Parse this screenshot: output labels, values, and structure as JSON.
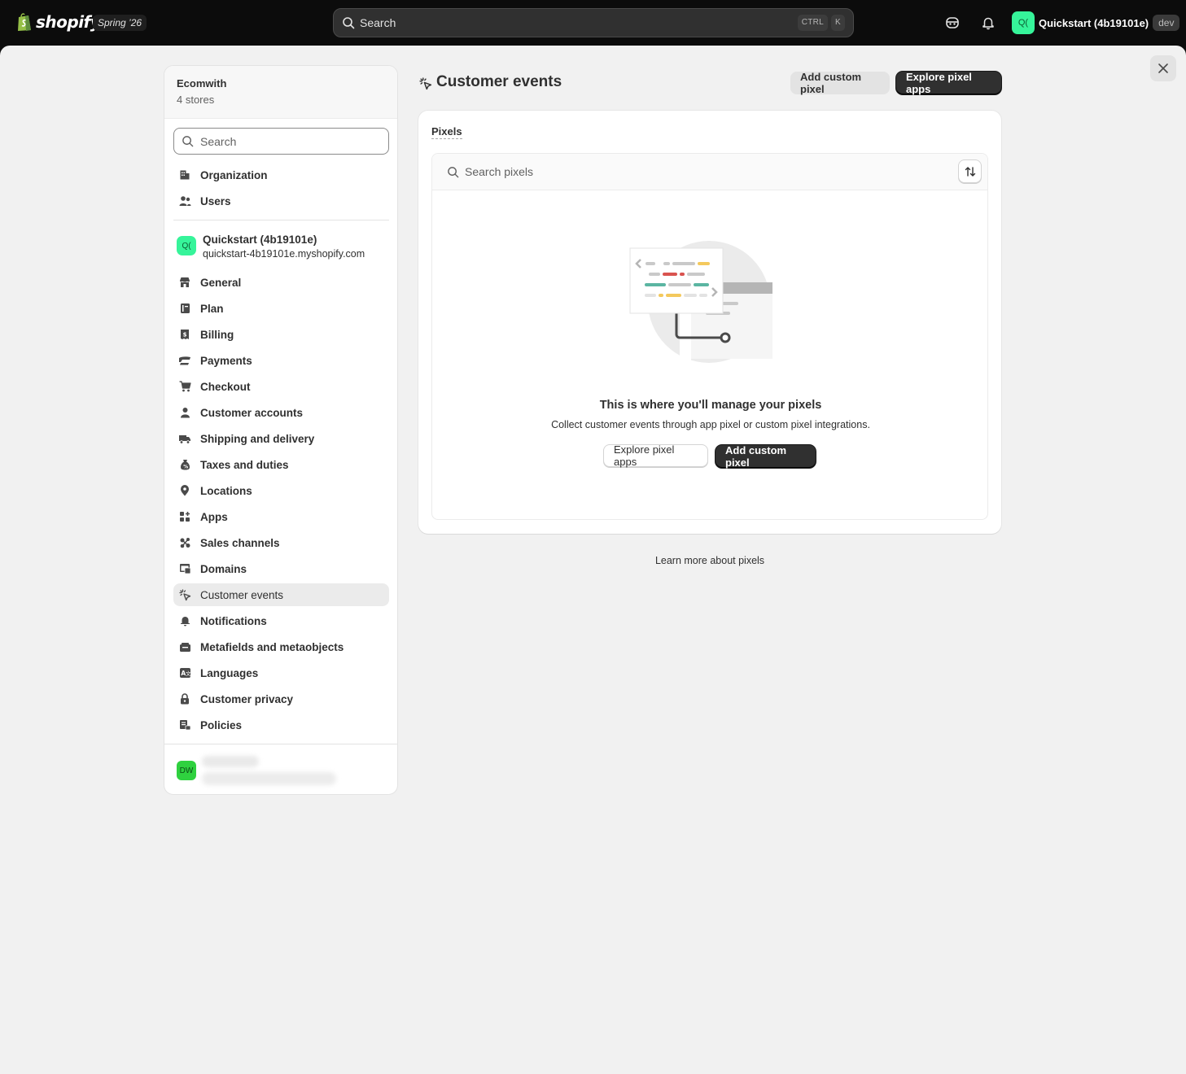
{
  "topbar": {
    "brand": "shopify",
    "release": "Spring ’26",
    "search_placeholder": "Search",
    "shortcut_ctrl": "CTRL",
    "shortcut_key": "K",
    "store_avatar": "Q(",
    "store_name": "Quickstart (4b19101e)",
    "store_tag": "dev"
  },
  "sidebar": {
    "org_name": "Ecomwith",
    "org_stores": "4 stores",
    "search_placeholder": "Search",
    "org_items": [
      {
        "label": "Organization",
        "icon": "organization-icon"
      },
      {
        "label": "Users",
        "icon": "users-icon"
      }
    ],
    "store": {
      "avatar": "Q(",
      "name": "Quickstart (4b19101e)",
      "url": "quickstart-4b19101e.myshopify.com"
    },
    "items": [
      {
        "label": "General",
        "icon": "store-icon"
      },
      {
        "label": "Plan",
        "icon": "plan-icon"
      },
      {
        "label": "Billing",
        "icon": "billing-icon"
      },
      {
        "label": "Payments",
        "icon": "payments-icon"
      },
      {
        "label": "Checkout",
        "icon": "cart-icon"
      },
      {
        "label": "Customer accounts",
        "icon": "person-icon"
      },
      {
        "label": "Shipping and delivery",
        "icon": "truck-icon"
      },
      {
        "label": "Taxes and duties",
        "icon": "tax-icon"
      },
      {
        "label": "Locations",
        "icon": "location-icon"
      },
      {
        "label": "Apps",
        "icon": "apps-icon"
      },
      {
        "label": "Sales channels",
        "icon": "channels-icon"
      },
      {
        "label": "Domains",
        "icon": "domains-icon"
      },
      {
        "label": "Customer events",
        "icon": "cursor-click-icon",
        "active": true
      },
      {
        "label": "Notifications",
        "icon": "bell-icon"
      },
      {
        "label": "Metafields and metaobjects",
        "icon": "metafields-icon"
      },
      {
        "label": "Languages",
        "icon": "languages-icon"
      },
      {
        "label": "Customer privacy",
        "icon": "lock-icon"
      },
      {
        "label": "Policies",
        "icon": "policies-icon"
      }
    ],
    "user_avatar": "DW"
  },
  "page": {
    "title": "Customer events",
    "add_custom_pixel": "Add custom pixel",
    "explore_pixel_apps": "Explore pixel apps"
  },
  "pixels_card": {
    "title": "Pixels",
    "search_placeholder": "Search pixels",
    "empty_heading": "This is where you'll manage your pixels",
    "empty_body": "Collect customer events through app pixel or custom pixel integrations.",
    "explore_button": "Explore pixel apps",
    "add_button": "Add custom pixel"
  },
  "learn_more": "Learn more about pixels",
  "colors": {
    "topbar": "#0c0c0c",
    "canvas": "#f1f1f1",
    "primary_button": "#303030",
    "store_avatar": "#36f49a",
    "user_avatar": "#2fd13f"
  }
}
